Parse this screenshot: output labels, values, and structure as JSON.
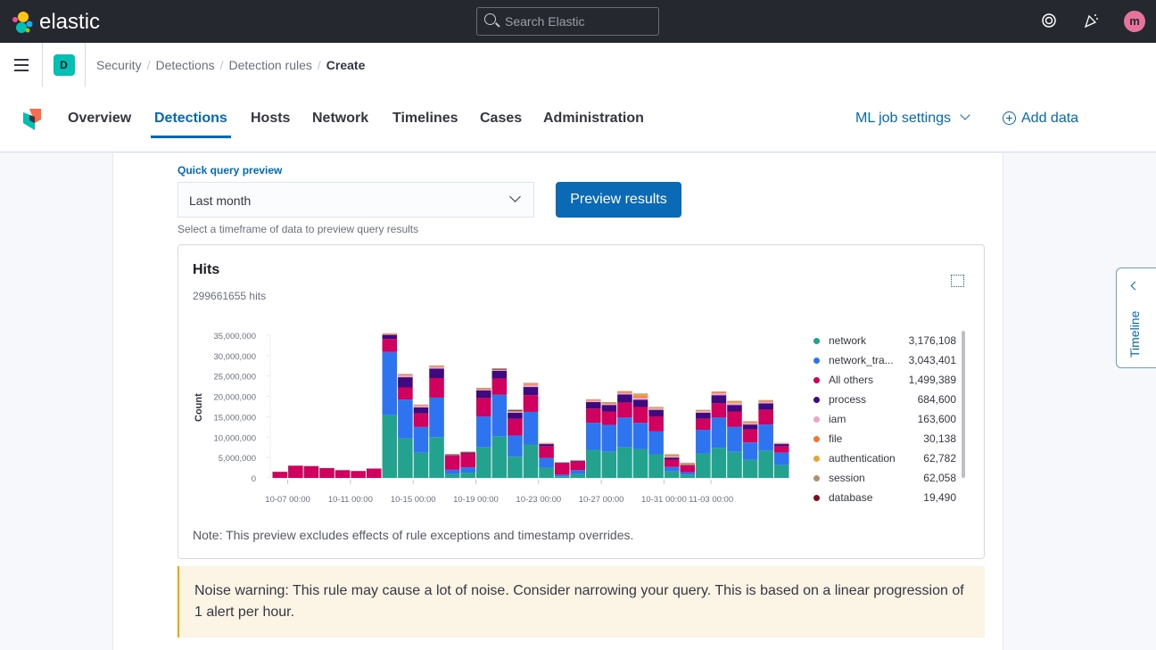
{
  "header": {
    "brand": "elastic",
    "search_placeholder": "Search Elastic",
    "avatar": "m",
    "icons": [
      "help-icon",
      "newsfeed-icon"
    ]
  },
  "breadcrumbs": {
    "space": "D",
    "items": [
      "Security",
      "Detections",
      "Detection rules",
      "Create"
    ]
  },
  "nav": {
    "tabs": [
      "Overview",
      "Detections",
      "Hosts",
      "Network",
      "Timelines",
      "Cases",
      "Administration"
    ],
    "active": "Detections",
    "ml_settings": "ML job settings",
    "add_data": "Add data"
  },
  "preview": {
    "label": "Quick query preview",
    "selected": "Last month",
    "button": "Preview results",
    "help": "Select a timeframe of data to preview query results"
  },
  "hits": {
    "title": "Hits",
    "count": "299661655 hits",
    "note": "Note: This preview excludes effects of rule exceptions and timestamp overrides."
  },
  "warning": "Noise warning: This rule may cause a lot of noise. Consider narrowing your query. This is based on a linear progression of 1 alert per hour.",
  "timeline": "Timeline",
  "legend": [
    {
      "name": "network",
      "value": "3,176,108",
      "color": "#23a38f"
    },
    {
      "name": "network_tra...",
      "value": "3,043,401",
      "color": "#2e73ef"
    },
    {
      "name": "All others",
      "value": "1,499,389",
      "color": "#d1005e"
    },
    {
      "name": "process",
      "value": "684,600",
      "color": "#3e0a7d"
    },
    {
      "name": "iam",
      "value": "163,600",
      "color": "#f3a3c8"
    },
    {
      "name": "file",
      "value": "30,138",
      "color": "#f2762e"
    },
    {
      "name": "authentication",
      "value": "62,782",
      "color": "#e8a23a"
    },
    {
      "name": "session",
      "value": "62,058",
      "color": "#b0906f"
    },
    {
      "name": "database",
      "value": "19,490",
      "color": "#7a0e1a"
    }
  ],
  "chart_data": {
    "type": "bar",
    "stacked": true,
    "ylabel": "Count",
    "ylim": [
      0,
      35000000
    ],
    "yticks": [
      "0",
      "5,000,000",
      "10,000,000",
      "15,000,000",
      "20,000,000",
      "25,000,000",
      "30,000,000",
      "35,000,000"
    ],
    "xticks": [
      {
        "label": "10-07 00:00",
        "day": 1
      },
      {
        "label": "10-11 00:00",
        "day": 5
      },
      {
        "label": "10-15 00:00",
        "day": 9
      },
      {
        "label": "10-19 00:00",
        "day": 13
      },
      {
        "label": "10-23 00:00",
        "day": 17
      },
      {
        "label": "10-27 00:00",
        "day": 21
      },
      {
        "label": "10-31 00:00",
        "day": 25
      },
      {
        "label": "11-03 00:00",
        "day": 28
      }
    ],
    "units": 1000000,
    "series": [
      {
        "name": "network",
        "color": "#23a38f",
        "values": [
          0,
          0,
          0,
          0,
          0,
          0,
          0,
          15.4,
          9.7,
          6.2,
          10.0,
          1.0,
          1.3,
          7.5,
          10.2,
          5.2,
          8.2,
          2.5,
          0.4,
          1.0,
          6.9,
          6.4,
          7.5,
          7.1,
          5.8,
          1.6,
          0.8,
          6.0,
          7.4,
          6.4,
          4.5,
          6.7,
          3.2
        ]
      },
      {
        "name": "network_traffic",
        "color": "#2e73ef",
        "values": [
          0,
          0,
          0,
          0,
          0,
          0,
          0,
          15.5,
          9.5,
          6.3,
          9.7,
          1.0,
          1.3,
          7.6,
          10.2,
          5.2,
          8.0,
          2.4,
          0.4,
          0.9,
          6.6,
          6.6,
          7.3,
          6.4,
          5.6,
          1.1,
          0.6,
          5.8,
          7.4,
          6.1,
          4.2,
          6.4,
          3.0
        ]
      },
      {
        "name": "All others",
        "color": "#d1005e",
        "values": [
          1.5,
          3.0,
          2.9,
          2.4,
          1.9,
          1.7,
          2.3,
          3.2,
          3.0,
          3.3,
          4.8,
          3.4,
          3.4,
          4.5,
          4.0,
          4.1,
          4.1,
          2.9,
          2.7,
          2.1,
          3.5,
          3.3,
          3.7,
          3.9,
          3.7,
          1.8,
          1.6,
          2.7,
          3.5,
          3.8,
          3.2,
          3.6,
          1.6
        ]
      },
      {
        "name": "process",
        "color": "#3e0a7d",
        "values": [
          0,
          0,
          0,
          0,
          0,
          0,
          0,
          1.0,
          2.5,
          1.5,
          2.3,
          0.2,
          0.3,
          1.9,
          1.9,
          1.5,
          2.0,
          0.5,
          0.2,
          0.2,
          1.6,
          1.6,
          2.0,
          1.8,
          1.6,
          0.5,
          0.2,
          1.5,
          2.0,
          1.6,
          1.2,
          1.6,
          0.5
        ]
      },
      {
        "name": "iam",
        "color": "#f3a3c8",
        "values": [
          0,
          0,
          0,
          0,
          0,
          0,
          0,
          0.2,
          0.5,
          0.4,
          0.5,
          0.1,
          0.1,
          0.3,
          0.2,
          0.2,
          0.6,
          0.2,
          0.1,
          0.1,
          0.4,
          0.3,
          0.4,
          0.5,
          0.3,
          0.2,
          0.1,
          0.4,
          0.5,
          0.5,
          0.3,
          0.4,
          0.2
        ]
      },
      {
        "name": "file",
        "color": "#f2762e",
        "values": [
          0,
          0,
          0,
          0,
          0,
          0,
          0,
          0.1,
          0.1,
          0.1,
          0.1,
          0,
          0,
          0.1,
          0,
          0,
          0.1,
          0,
          0,
          0,
          0.1,
          0.2,
          0.1,
          0.3,
          0,
          0,
          0,
          0,
          0.2,
          0,
          0.1,
          0.1,
          0
        ]
      },
      {
        "name": "authentication",
        "color": "#e8a23a",
        "values": [
          0,
          0,
          0,
          0,
          0,
          0,
          0,
          0.1,
          0.1,
          0.1,
          0.1,
          0.1,
          0.1,
          0.1,
          0,
          0,
          0.1,
          0.1,
          0,
          0,
          0.1,
          0.1,
          0.1,
          0.5,
          0.2,
          0.3,
          0.2,
          0.1,
          0.1,
          0.3,
          0.2,
          0.1,
          0
        ]
      },
      {
        "name": "session",
        "color": "#b0906f",
        "values": [
          0,
          0,
          0,
          0,
          0,
          0,
          0,
          0,
          0.1,
          0.1,
          0.1,
          0.1,
          0,
          0.1,
          0.1,
          0.3,
          0.2,
          0,
          0.1,
          0.1,
          0.1,
          0.1,
          0.2,
          0.2,
          0.2,
          0.3,
          0.2,
          0.2,
          0.1,
          0.2,
          0.2,
          0.2,
          0.1
        ]
      },
      {
        "name": "database",
        "color": "#7a0e1a",
        "values": [
          0,
          0,
          0,
          0,
          0,
          0,
          0,
          0,
          0,
          0,
          0,
          0,
          0,
          0,
          0.2,
          0.2,
          0,
          0,
          0,
          0,
          0,
          0,
          0,
          0,
          0,
          0,
          0,
          0,
          0,
          0,
          0,
          0,
          0
        ]
      }
    ]
  }
}
